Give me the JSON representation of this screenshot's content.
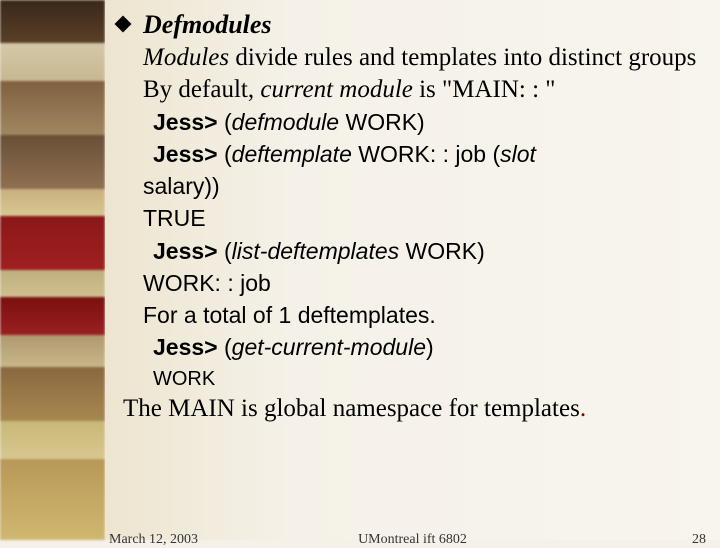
{
  "slide": {
    "title": "Defmodules",
    "line1_italic": "Modules",
    "line1_rest": " divide rules and templates into distinct groups",
    "line2_a": "By default, ",
    "line2_b": "current module",
    "line2_c": "  is  \"MAIN: : \"",
    "prompt": "Jess>",
    "cmd1_a": " (",
    "cmd1_b": "defmodule",
    "cmd1_c": " WORK)",
    "cmd2_a": " (",
    "cmd2_b": "deftemplate",
    "cmd2_c": " WORK: : job (",
    "cmd2_d": "slot",
    "cmd2_e": " salary))",
    "true": "  TRUE",
    "cmd3_a": " (",
    "cmd3_b": "list-deftemplates",
    "cmd3_c": " WORK)",
    "out_job": " WORK: : job",
    "out_total": "  For a total of 1 deftemplates.",
    "cmd4_a": " (",
    "cmd4_b": "get-current-module",
    "cmd4_c": ")",
    "out_work": "WORK",
    "closing_a": "The  MAIN is global namespace for templates",
    "closing_dot": "."
  },
  "footer": {
    "date": "March 12, 2003",
    "center": "UMontreal ift 6802",
    "page": "28"
  }
}
